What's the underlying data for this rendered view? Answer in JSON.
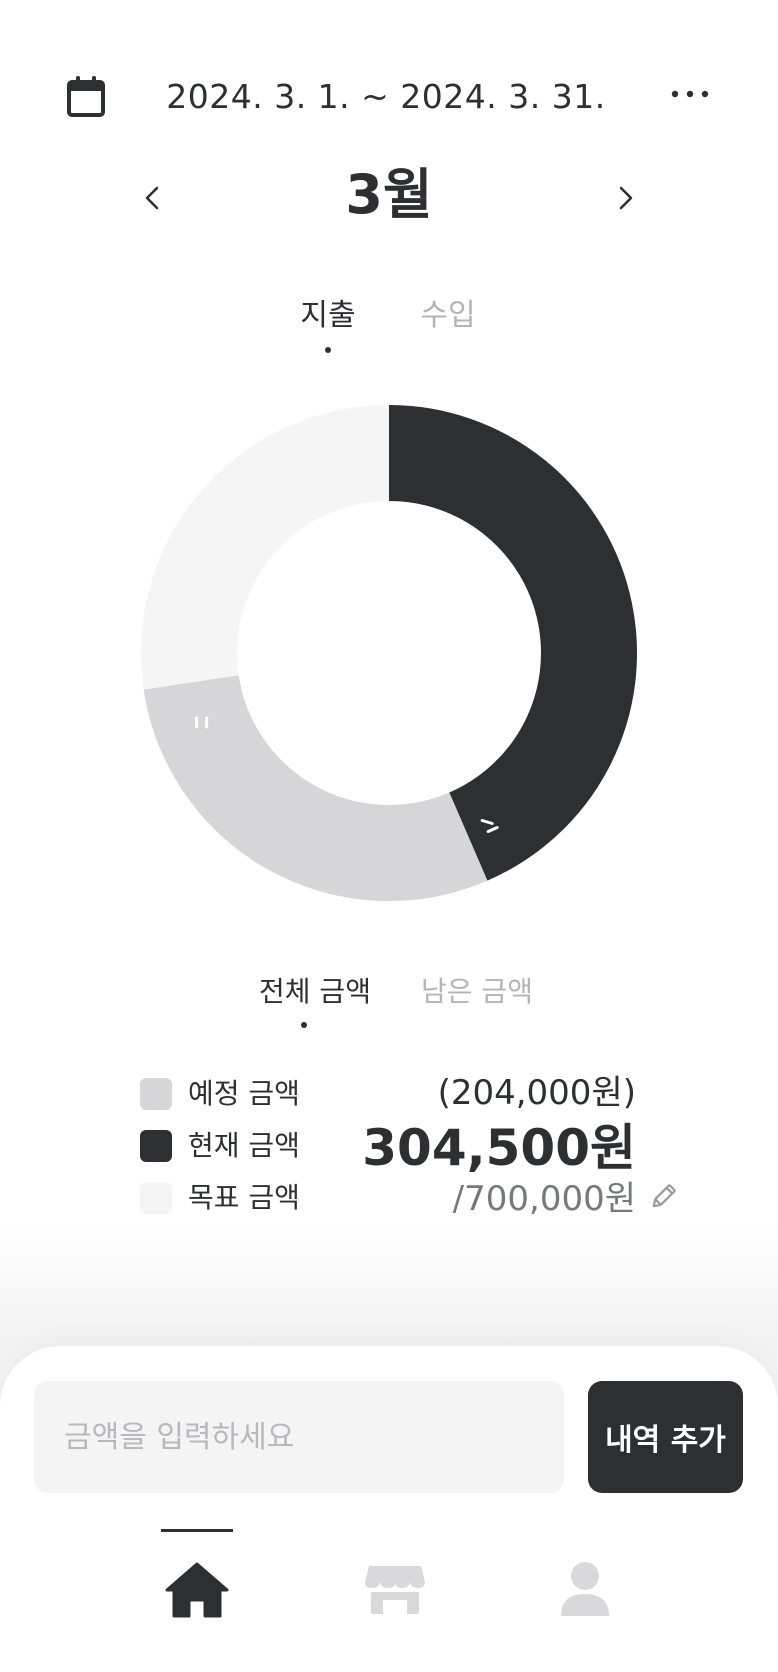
{
  "header": {
    "date_range": "2024. 3. 1. ~ 2024. 3. 31.",
    "icons": {
      "left": "calendar-icon",
      "right": "more-icon"
    }
  },
  "month_nav": {
    "title": "3월",
    "prev_icon": "chevron-left-icon",
    "next_icon": "chevron-right-icon"
  },
  "type_tabs": [
    {
      "label": "지출",
      "active": true
    },
    {
      "label": "수입",
      "active": false
    }
  ],
  "chart_data": {
    "type": "pie",
    "style": "donut",
    "goal": 700000,
    "current": 304500,
    "planned": 204000,
    "colors": {
      "current": "#2e2f33",
      "planned": "#d6d6d8",
      "goal": "#f5f5f6"
    }
  },
  "amount_tabs": [
    {
      "label": "전체 금액",
      "active": true
    },
    {
      "label": "남은 금액",
      "active": false
    }
  ],
  "legend": {
    "planned": {
      "label": "예정 금액",
      "value": "(204,000원)",
      "color": "#d6d6d8"
    },
    "current": {
      "label": "현재 금액",
      "value": "304,500원",
      "color": "#2e2f33"
    },
    "goal": {
      "label": "목표 금액",
      "value": "/700,000원",
      "color": "#f5f5f6",
      "edit_icon": "pencil-icon"
    }
  },
  "input_bar": {
    "placeholder": "금액을 입력하세요",
    "add_button_label": "내역 추가"
  },
  "bottom_nav": {
    "items": [
      {
        "icon": "home-icon",
        "active": true
      },
      {
        "icon": "store-icon",
        "active": false
      },
      {
        "icon": "profile-icon",
        "active": false
      }
    ]
  }
}
